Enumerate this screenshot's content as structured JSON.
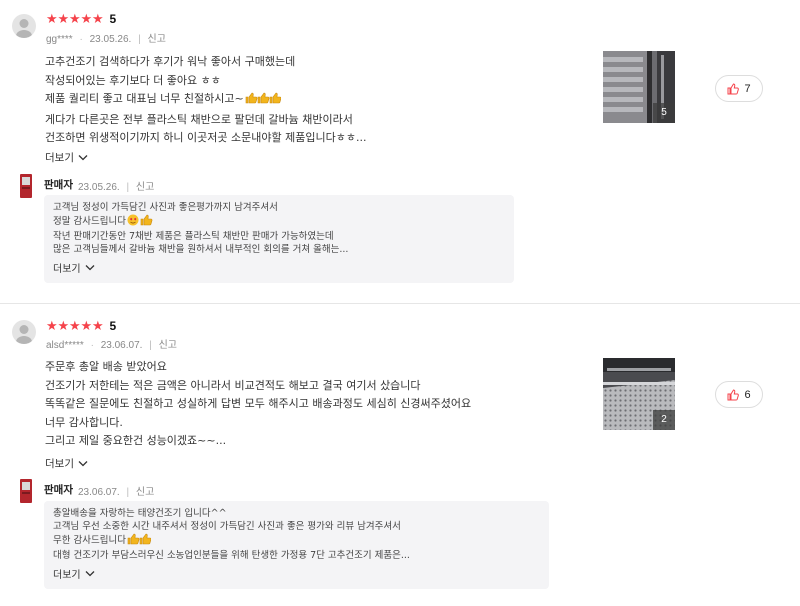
{
  "reviews": [
    {
      "rating_text": "5",
      "user": "gg****",
      "date": "23.05.26.",
      "report_label": "신고",
      "body_lines": [
        "고추건조기 검색하다가 후기가 워낙 좋아서 구매했는데",
        "작성되어있는 후기보다 더 좋아요 ㅎㅎ",
        "제품 퀄리티 좋고 대표님 너무 친절하시고~",
        "게다가 다른곳은 전부 플라스틱 채반으로 팔던데 갈바늄 채반이라서",
        "건조하면 위생적이기까지 하니 이곳저곳 소문내야할 제품입니다ㅎㅎ..."
      ],
      "more_label": "더보기",
      "image_count": "5",
      "like_count": "7",
      "seller": {
        "name": "판매자",
        "date": "23.05.26.",
        "report_label": "신고",
        "reply_lines": [
          "고객님 정성이 가득담긴 사진과 좋은평가까지 남겨주셔서",
          "정말 감사드립니다",
          "작년 판매기간동안 7채반 제품은 플라스틱 채반만 판매가 가능하였는데",
          "많은 고객님들께서 갈바늄 채반을 원하셔서 내부적인 회의를 거쳐 올해는..."
        ],
        "more_label": "더보기"
      }
    },
    {
      "rating_text": "5",
      "user": "alsd*****",
      "date": "23.06.07.",
      "report_label": "신고",
      "body_lines": [
        "주문후 총알 배송 받았어요",
        "건조기가 저한테는 적은 금액은 아니라서 비교견적도 해보고 결국 여기서 샀습니다",
        "똑똑같은 질문에도 친절하고 성실하게 답변 모두 해주시고 배송과정도 세심히 신경써주셨어요",
        "너무 감사합니다.",
        "그리고 제일 중요한건 성능이겠죠~~..."
      ],
      "more_label": "더보기",
      "image_count": "2",
      "like_count": "6",
      "seller": {
        "name": "판매자",
        "date": "23.06.07.",
        "report_label": "신고",
        "reply_lines": [
          "총알배송을 자랑하는 태양건조기 입니다^^",
          "고객님 우선 소중한 시간 내주셔서 정성이 가득담긴 사진과 좋은 평가와 리뷰 남겨주셔서",
          "무한 감사드립니다",
          "대형 건조기가 부담스러우신 소농업인분들을 위해 탄생한 가정용 7단 고추건조기 제품은..."
        ],
        "more_label": "더보기"
      }
    }
  ],
  "icons": {
    "star": "star-icon",
    "like": "thumbs-up-icon",
    "more": "chevron-down-icon"
  },
  "colors": {
    "star": "#f5434b",
    "like_icon": "#f5434b",
    "seller_icon": "#b3262d"
  }
}
